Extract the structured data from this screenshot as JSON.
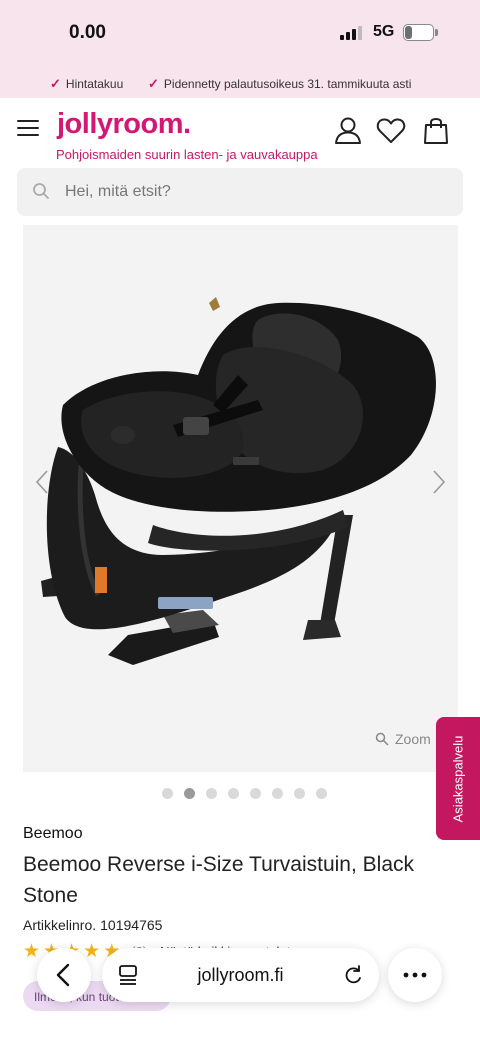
{
  "status_bar": {
    "time": "0.00",
    "network": "5G",
    "battery": "24",
    "battery_level": 0.24
  },
  "promo": {
    "item1": "Hintatakuu",
    "item2": "Pidennetty palautusoikeus 31. tammikuuta asti"
  },
  "header": {
    "logo": "jollyroom.",
    "tagline": "Pohjoismaiden suurin lasten- ja vauvakauppa"
  },
  "search": {
    "placeholder": "Hei, mitä etsit?"
  },
  "gallery": {
    "zoom_label": "Zoom",
    "image_count": 8,
    "active_index": 1
  },
  "side_tab": {
    "label": "Asiakaspalvelu"
  },
  "product": {
    "brand": "Beemoo",
    "title": "Beemoo Reverse i-Size Turvaistuin, Black Stone",
    "article_label": "Artikkelinro.",
    "article_number": "10194765",
    "rating": 4.5,
    "review_count": "(2)",
    "reviews_link": "Näytä kaikki arvostelut",
    "notify_label": "Ilmoita, kun tuote"
  },
  "browser": {
    "url": "jollyroom.fi"
  },
  "colors": {
    "brand": "#d31772",
    "promo_bg": "#f8e4ec",
    "side_tab": "#c3185f",
    "star": "#f2b11b"
  },
  "icons": [
    "menu-icon",
    "user-icon",
    "heart-icon",
    "bag-icon",
    "search-icon",
    "chevron-left-icon",
    "chevron-right-icon",
    "zoom-icon",
    "back-icon",
    "tabs-icon",
    "reload-icon",
    "more-icon"
  ]
}
